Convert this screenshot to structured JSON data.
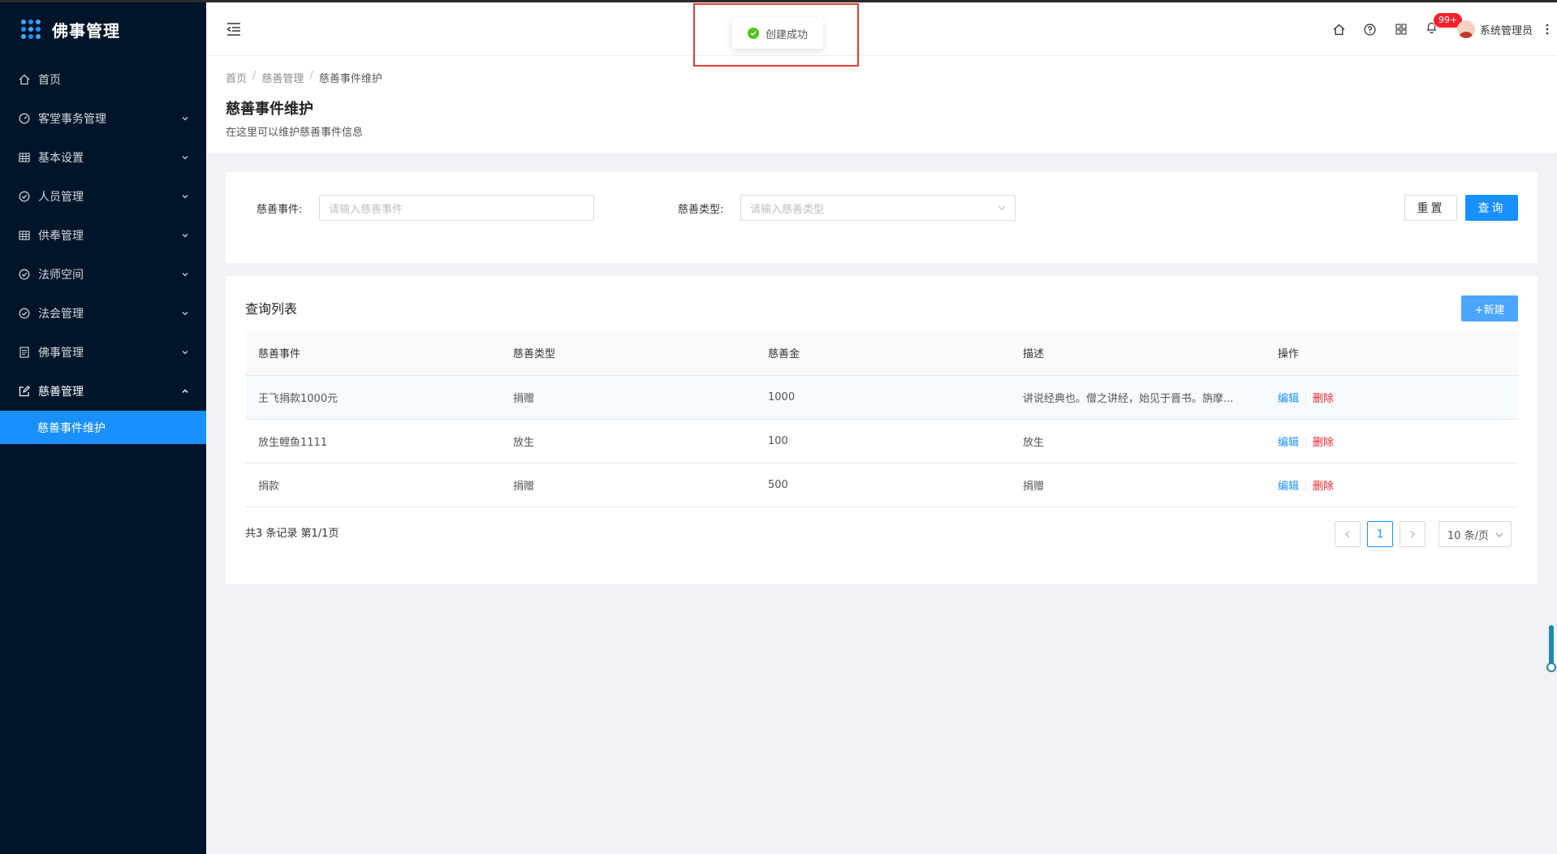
{
  "app": {
    "title": "佛事管理"
  },
  "sidebar": {
    "items": [
      {
        "label": "首页",
        "icon": "home-icon",
        "has_children": false
      },
      {
        "label": "客堂事务管理",
        "icon": "dashboard-icon",
        "has_children": true
      },
      {
        "label": "基本设置",
        "icon": "table-icon",
        "has_children": true
      },
      {
        "label": "人员管理",
        "icon": "check-circle-icon",
        "has_children": true
      },
      {
        "label": "供奉管理",
        "icon": "table-icon",
        "has_children": true
      },
      {
        "label": "法师空间",
        "icon": "check-circle-icon",
        "has_children": true
      },
      {
        "label": "法会管理",
        "icon": "check-circle-icon",
        "has_children": true
      },
      {
        "label": "佛事管理",
        "icon": "profile-icon",
        "has_children": true
      },
      {
        "label": "慈善管理",
        "icon": "edit-icon",
        "has_children": true,
        "open": true
      }
    ],
    "active_subitem": "慈善事件维护"
  },
  "header": {
    "notification_badge": "99+",
    "user_name": "系统管理员"
  },
  "toast": {
    "message": "创建成功",
    "type": "success"
  },
  "breadcrumb": [
    "首页",
    "慈善管理",
    "慈善事件维护"
  ],
  "page": {
    "title": "慈善事件维护",
    "description": "在这里可以维护慈善事件信息"
  },
  "search": {
    "event_label": "慈善事件:",
    "event_placeholder": "请输入慈善事件",
    "type_label": "慈善类型:",
    "type_placeholder": "请输入慈善类型",
    "reset_label": "重置",
    "query_label": "查询"
  },
  "table": {
    "title": "查询列表",
    "new_label": "+新建",
    "columns": [
      "慈善事件",
      "慈善类型",
      "慈善金",
      "描述",
      "操作"
    ],
    "rows": [
      {
        "event": "王飞捐款1000元",
        "type": "捐赠",
        "amount": "1000",
        "desc": "讲说经典也。僧之讲经，始见于晋书。旃摩...",
        "edit": "编辑",
        "del": "删除"
      },
      {
        "event": "放生鲤鱼1111",
        "type": "放生",
        "amount": "100",
        "desc": "放生",
        "edit": "编辑",
        "del": "删除"
      },
      {
        "event": "捐款",
        "type": "捐赠",
        "amount": "500",
        "desc": "捐赠",
        "edit": "编辑",
        "del": "删除"
      }
    ]
  },
  "pagination": {
    "total_text": "共3 条记录 第1/1页",
    "current_page": "1",
    "page_size": "10 条/页"
  },
  "colors": {
    "primary": "#1890ff",
    "sidebar_bg": "#001529",
    "danger": "#f5222d",
    "success": "#52c41a"
  }
}
